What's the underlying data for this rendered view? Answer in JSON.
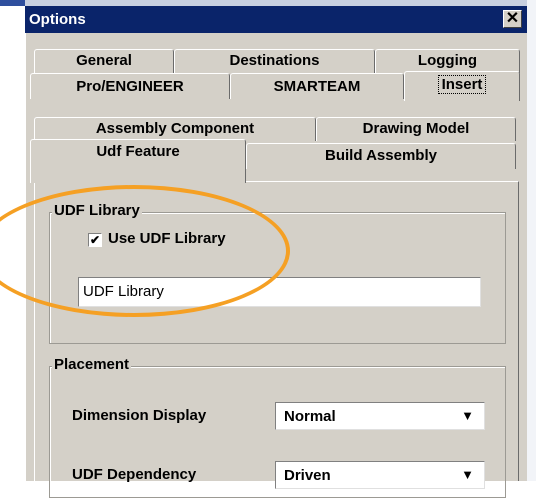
{
  "window": {
    "title": "Options",
    "close_label": "✕"
  },
  "tabs_row1": [
    "General",
    "Destinations",
    "Logging"
  ],
  "tabs_row2": [
    "Pro/ENGINEER",
    "SMARTEAM",
    "Insert"
  ],
  "subtabs_row1": [
    "Assembly Component",
    "Drawing Model"
  ],
  "subtabs_row2": [
    "Udf Feature",
    "Build Assembly"
  ],
  "udf_library": {
    "legend": "UDF Library",
    "checkbox_label": "Use UDF Library",
    "checked": true,
    "field_value": "UDF Library"
  },
  "placement": {
    "legend": "Placement",
    "dimension_display_label": "Dimension Display",
    "dimension_display_value": "Normal",
    "udf_dependency_label": "UDF Dependency",
    "udf_dependency_value": "Driven"
  },
  "colors": {
    "title_bar": "#0a246a",
    "dialog_bg": "#d4d0c8",
    "highlight_ring": "#f5a024"
  }
}
